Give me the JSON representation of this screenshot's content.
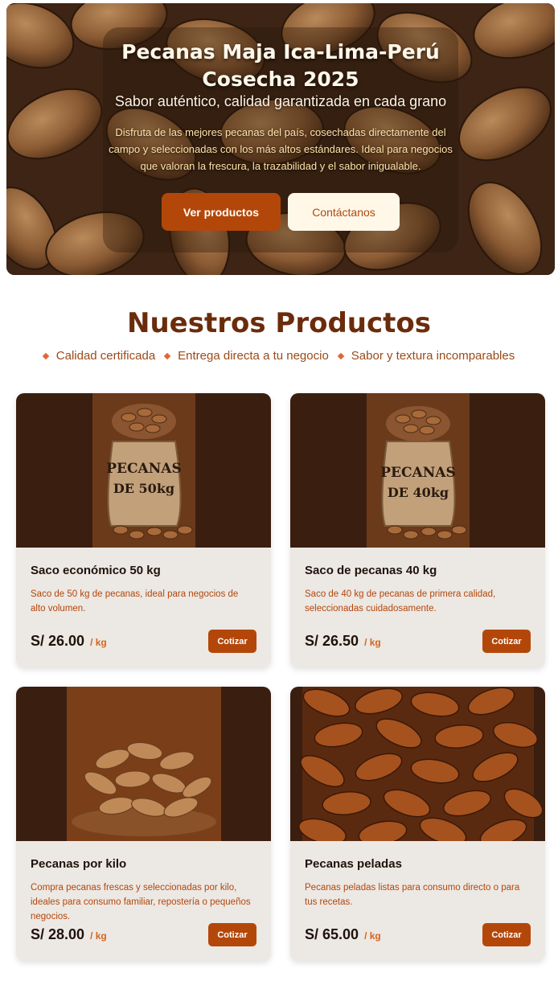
{
  "hero": {
    "title": "Pecanas Maja Ica-Lima-Perú Cosecha 2025",
    "subtitle": "Sabor auténtico, calidad garantizada en cada grano",
    "description": "Disfruta de las mejores pecanas del país, cosechadas directamente del campo y seleccionadas con los más altos estándares. Ideal para negocios que valoran la frescura, la trazabilidad y el sabor inigualable.",
    "btn_products": "Ver productos",
    "btn_contact": "Contáctanos"
  },
  "section": {
    "title": "Nuestros Productos",
    "features": [
      "Calidad certificada",
      "Entrega directa a tu negocio",
      "Sabor y textura incomparables"
    ]
  },
  "products": [
    {
      "name": "Saco económico 50 kg",
      "description": "Saco de 50 kg de pecanas, ideal para negocios de alto volumen.",
      "price": "S/ 26.00",
      "unit": "/ kg",
      "button": "Cotizar",
      "image_label_line1": "PECANAS",
      "image_label_line2": "DE 50kg"
    },
    {
      "name": "Saco de pecanas 40 kg",
      "description": "Saco de 40 kg de pecanas de primera calidad, seleccionadas cuidadosamente.",
      "price": "S/ 26.50",
      "unit": "/ kg",
      "button": "Cotizar",
      "image_label_line1": "PECANAS",
      "image_label_line2": "DE 40kg"
    },
    {
      "name": "Pecanas por kilo",
      "description": "Compra pecanas frescas y seleccionadas por kilo, ideales para consumo familiar, repostería o pequeños negocios.",
      "price": "S/ 28.00",
      "unit": "/ kg",
      "button": "Cotizar"
    },
    {
      "name": "Pecanas peladas",
      "description": "Pecanas peladas listas para consumo directo o para tus recetas.",
      "price": "S/ 65.00",
      "unit": "/ kg",
      "button": "Cotizar"
    }
  ],
  "colors": {
    "accent": "#b3470a",
    "title": "#6b2c0c",
    "card_bg": "#ece8e4"
  }
}
